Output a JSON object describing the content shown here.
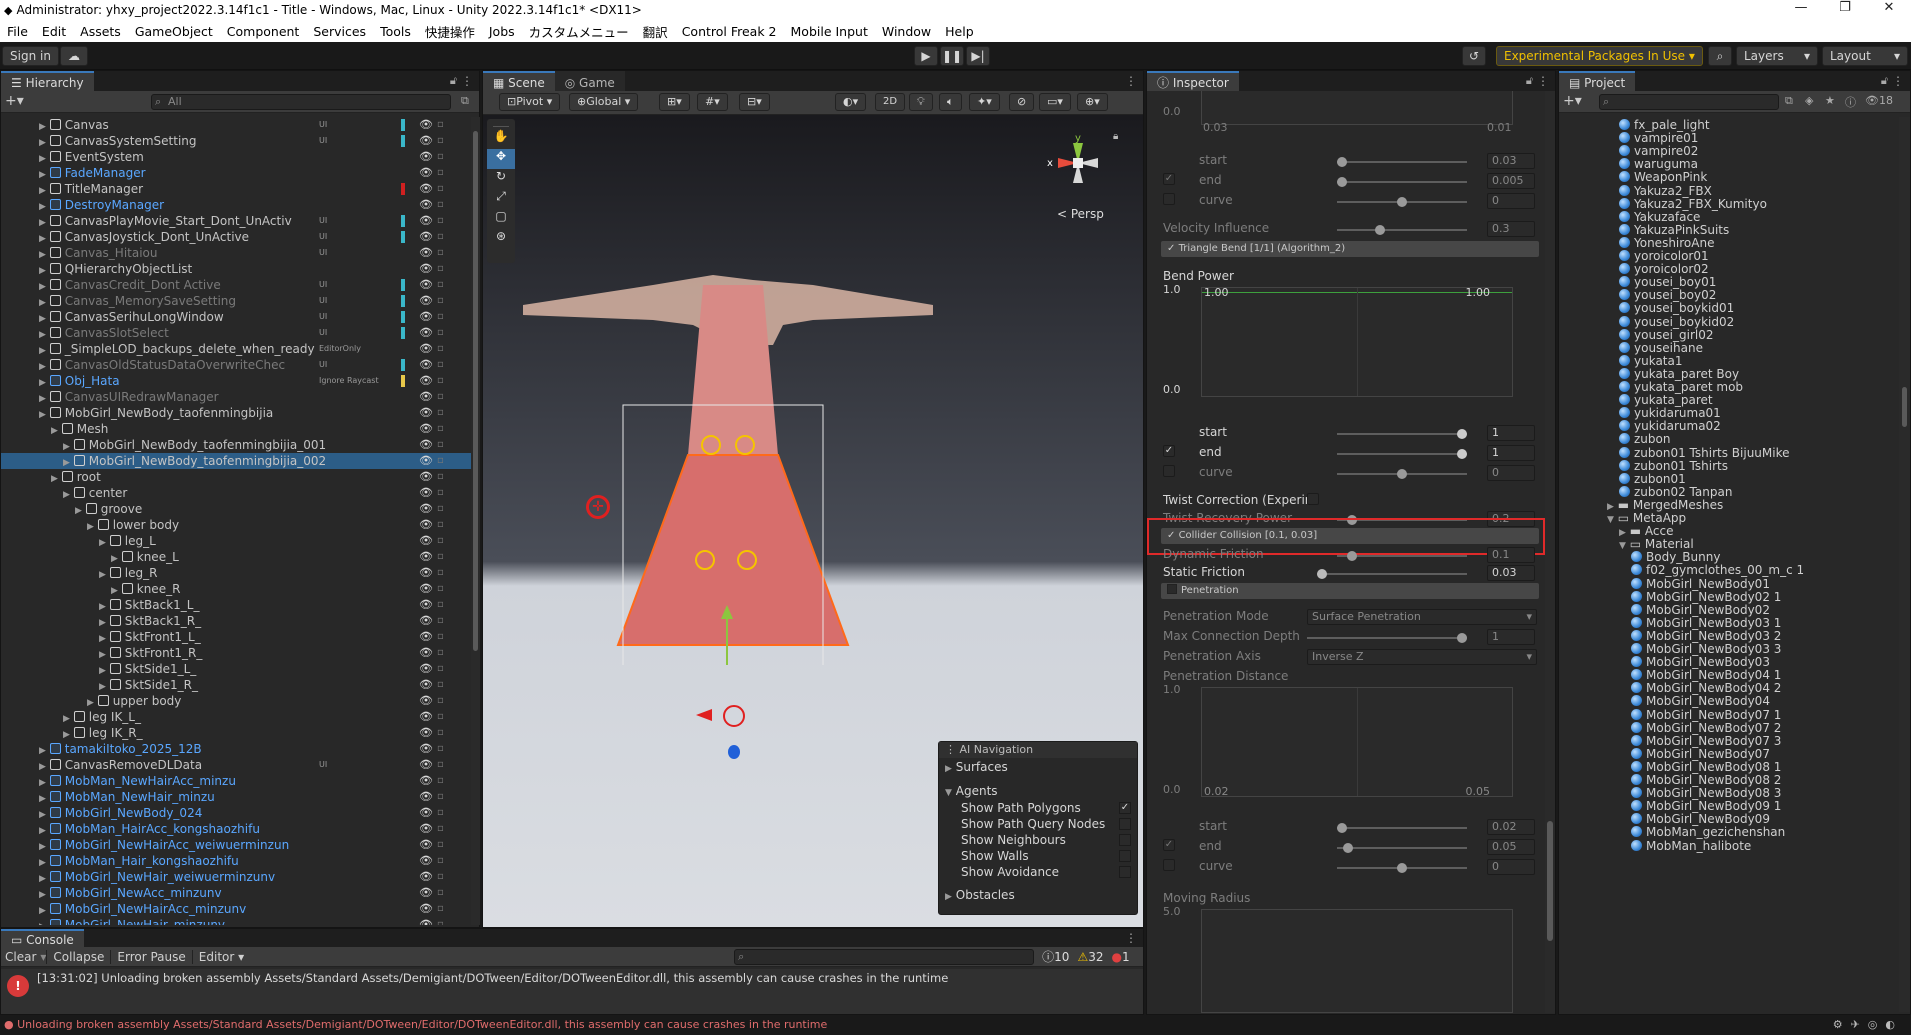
{
  "window": {
    "title": "Administrator: yhxy_project2022.3.14f1c1 - Title - Windows, Mac, Linux - Unity 2022.3.14f1c1* <DX11>"
  },
  "menu": [
    "File",
    "Edit",
    "Assets",
    "GameObject",
    "Component",
    "Services",
    "Tools",
    "快捷操作",
    "Jobs",
    "カスタムメニュー",
    "翻訳",
    "Control Freak 2",
    "Mobile Input",
    "Window",
    "Help"
  ],
  "toolbar": {
    "sign_in": "Sign in",
    "experimental": "Experimental Packages In Use ▾",
    "layers": "Layers",
    "layout": "Layout"
  },
  "hierarchy": {
    "tab": "Hierarchy",
    "search_placeholder": "All",
    "rows": [
      {
        "label": "Canvas",
        "indent": 0,
        "style": "n",
        "tag": "UI",
        "bar": "#3ab7c9"
      },
      {
        "label": "CanvasSystemSetting",
        "indent": 0,
        "style": "n",
        "tag": "UI",
        "bar": "#3ab7c9"
      },
      {
        "label": "EventSystem",
        "indent": 0,
        "style": "n",
        "tag": "",
        "bar": ""
      },
      {
        "label": "FadeManager",
        "indent": 0,
        "style": "b",
        "tag": "",
        "bar": ""
      },
      {
        "label": "TitleManager",
        "indent": 0,
        "style": "n",
        "tag": "",
        "bar": "#d02020"
      },
      {
        "label": "DestroyManager",
        "indent": 0,
        "style": "b",
        "tag": "",
        "bar": ""
      },
      {
        "label": "CanvasPlayMovie_Start_Dont_UnActiv",
        "indent": 0,
        "style": "n",
        "tag": "UI",
        "bar": "#3ab7c9"
      },
      {
        "label": "CanvasJoystick_Dont_UnActive",
        "indent": 0,
        "style": "n",
        "tag": "UI",
        "bar": "#3ab7c9"
      },
      {
        "label": "Canvas_Hitaiou",
        "indent": 0,
        "style": "g",
        "tag": "UI",
        "bar": ""
      },
      {
        "label": "QHierarchyObjectList",
        "indent": 0,
        "style": "n",
        "tag": "",
        "bar": ""
      },
      {
        "label": "CanvasCredit_Dont Active",
        "indent": 0,
        "style": "g",
        "tag": "UI",
        "bar": "#3ab7c9"
      },
      {
        "label": "Canvas_MemorySaveSetting",
        "indent": 0,
        "style": "g",
        "tag": "UI",
        "bar": "#3ab7c9"
      },
      {
        "label": "CanvasSerihuLongWindow",
        "indent": 0,
        "style": "n",
        "tag": "UI",
        "bar": "#3ab7c9"
      },
      {
        "label": "CanvasSlotSelect",
        "indent": 0,
        "style": "g",
        "tag": "UI",
        "bar": "#3ab7c9"
      },
      {
        "label": "_SimpleLOD_backups_delete_when_ready",
        "indent": 0,
        "style": "n",
        "tag": "EditorOnly",
        "bar": ""
      },
      {
        "label": "CanvasOldStatusDataOverwriteChec",
        "indent": 0,
        "style": "g",
        "tag": "UI",
        "bar": "#3ab7c9"
      },
      {
        "label": "Obj_Hata",
        "indent": 0,
        "style": "b",
        "tag": "Ignore Raycast",
        "bar": "#e8c84a"
      },
      {
        "label": "CanvasUIRedrawManager",
        "indent": 0,
        "style": "g",
        "tag": "",
        "bar": ""
      },
      {
        "label": "MobGirl_NewBody_taofenmingbijia",
        "indent": 0,
        "style": "n",
        "tag": "",
        "bar": ""
      },
      {
        "label": "Mesh",
        "indent": 1,
        "style": "n",
        "tag": "",
        "bar": ""
      },
      {
        "label": "MobGirl_NewBody_taofenmingbijia_001",
        "indent": 2,
        "style": "n",
        "tag": "",
        "bar": ""
      },
      {
        "label": "MobGirl_NewBody_taofenmingbijia_002",
        "indent": 2,
        "style": "sel",
        "tag": "",
        "bar": ""
      },
      {
        "label": "root",
        "indent": 1,
        "style": "n",
        "tag": "",
        "bar": ""
      },
      {
        "label": "center",
        "indent": 2,
        "style": "n",
        "tag": "",
        "bar": ""
      },
      {
        "label": "groove",
        "indent": 3,
        "style": "n",
        "tag": "",
        "bar": ""
      },
      {
        "label": "lower body",
        "indent": 4,
        "style": "n",
        "tag": "",
        "bar": ""
      },
      {
        "label": "leg_L",
        "indent": 5,
        "style": "n",
        "tag": "",
        "bar": ""
      },
      {
        "label": "knee_L",
        "indent": 6,
        "style": "n",
        "tag": "",
        "bar": ""
      },
      {
        "label": "leg_R",
        "indent": 5,
        "style": "n",
        "tag": "",
        "bar": ""
      },
      {
        "label": "knee_R",
        "indent": 6,
        "style": "n",
        "tag": "",
        "bar": ""
      },
      {
        "label": "SktBack1_L_",
        "indent": 5,
        "style": "n",
        "tag": "",
        "bar": ""
      },
      {
        "label": "SktBack1_R_",
        "indent": 5,
        "style": "n",
        "tag": "",
        "bar": ""
      },
      {
        "label": "SktFront1_L_",
        "indent": 5,
        "style": "n",
        "tag": "",
        "bar": ""
      },
      {
        "label": "SktFront1_R_",
        "indent": 5,
        "style": "n",
        "tag": "",
        "bar": ""
      },
      {
        "label": "SktSide1_L_",
        "indent": 5,
        "style": "n",
        "tag": "",
        "bar": ""
      },
      {
        "label": "SktSide1_R_",
        "indent": 5,
        "style": "n",
        "tag": "",
        "bar": ""
      },
      {
        "label": "upper body",
        "indent": 4,
        "style": "n",
        "tag": "",
        "bar": ""
      },
      {
        "label": "leg IK_L_",
        "indent": 2,
        "style": "n",
        "tag": "",
        "bar": ""
      },
      {
        "label": "leg IK_R_",
        "indent": 2,
        "style": "n",
        "tag": "",
        "bar": ""
      },
      {
        "label": "tamakiItoko_2025_12B",
        "indent": 0,
        "style": "b",
        "tag": "",
        "bar": ""
      },
      {
        "label": "CanvasRemoveDLData",
        "indent": 0,
        "style": "n",
        "tag": "UI",
        "bar": ""
      },
      {
        "label": "MobMan_NewHairAcc_minzu",
        "indent": 0,
        "style": "b",
        "tag": "",
        "bar": ""
      },
      {
        "label": "MobMan_NewHair_minzu",
        "indent": 0,
        "style": "b",
        "tag": "",
        "bar": ""
      },
      {
        "label": "MobGirl_NewBody_024",
        "indent": 0,
        "style": "b",
        "tag": "",
        "bar": ""
      },
      {
        "label": "MobMan_HairAcc_kongshaozhifu",
        "indent": 0,
        "style": "b",
        "tag": "",
        "bar": ""
      },
      {
        "label": "MobGirl_NewHairAcc_weiwuerminzun",
        "indent": 0,
        "style": "b",
        "tag": "",
        "bar": ""
      },
      {
        "label": "MobMan_Hair_kongshaozhifu",
        "indent": 0,
        "style": "b",
        "tag": "",
        "bar": ""
      },
      {
        "label": "MobGirl_NewHair_weiwuerminzunv",
        "indent": 0,
        "style": "b",
        "tag": "",
        "bar": ""
      },
      {
        "label": "MobGirl_NewAcc_minzunv",
        "indent": 0,
        "style": "b",
        "tag": "",
        "bar": ""
      },
      {
        "label": "MobGirl_NewHairAcc_minzunv",
        "indent": 0,
        "style": "b",
        "tag": "",
        "bar": ""
      },
      {
        "label": "MobGirl_NewHair_minzunv",
        "indent": 0,
        "style": "b",
        "tag": "",
        "bar": ""
      }
    ]
  },
  "scene": {
    "tabs": [
      "Scene",
      "Game"
    ],
    "pivot": "Pivot ▾",
    "global": "Global ▾",
    "mode_2d": "2D",
    "persp": "< Persp",
    "gizmo_axes": {
      "y": "y",
      "x": "x"
    },
    "overlay": {
      "title": "AI Navigation",
      "surfaces": "Surfaces",
      "agents": "Agents",
      "items": [
        "Show Path Polygons",
        "Show Path Query Nodes",
        "Show Neighbours",
        "Show Walls",
        "Show Avoidance"
      ],
      "obstacles": "Obstacles"
    }
  },
  "inspector": {
    "tab": "Inspector",
    "top_vals": {
      "a": "0.0",
      "b": "0.03",
      "c": "0.01"
    },
    "group1": {
      "start": "start",
      "start_v": "0.03",
      "end": "end",
      "end_v": "0.005",
      "curve": "curve",
      "curve_v": "0"
    },
    "velocity": {
      "label": "Velocity Influence",
      "value": "0.3"
    },
    "triangle_bend": "Triangle Bend [1/1] (Algorithm_2)",
    "bend_power": {
      "label": "Bend Power",
      "y_top": "1.0",
      "y_bot": "0.0",
      "left": "1.00",
      "right": "1.00"
    },
    "group2": {
      "start_v": "1",
      "end_v": "1",
      "curve_v": "0"
    },
    "twist": {
      "label": "Twist Correction (Experin"
    },
    "twist_recovery": {
      "label": "Twist Recovery Power",
      "value": "0.2"
    },
    "collider": "Collider Collision [0.1, 0.03]",
    "dynamic_friction": {
      "label": "Dynamic Friction",
      "value": "0.1"
    },
    "static_friction": {
      "label": "Static Friction",
      "value": "0.03"
    },
    "penetration": "Penetration",
    "pen_mode": {
      "label": "Penetration Mode",
      "value": "Surface Penetration"
    },
    "max_depth": {
      "label": "Max Connection Depth",
      "value": "1"
    },
    "pen_axis": {
      "label": "Penetration Axis",
      "value": "Inverse Z"
    },
    "pen_distance": {
      "label": "Penetration Distance",
      "y_top": "1.0",
      "y_bot": "0.0",
      "left": "0.02",
      "right": "0.05"
    },
    "group3": {
      "start_v": "0.02",
      "end_v": "0.05",
      "curve_v": "0"
    },
    "moving_radius": {
      "label": "Moving Radius",
      "y_top": "5.0"
    }
  },
  "project": {
    "tab": "Project",
    "count": "18",
    "rows": [
      {
        "label": "fx_pale_light",
        "indent": 3,
        "type": "s"
      },
      {
        "label": "vampire01",
        "indent": 3,
        "type": "s"
      },
      {
        "label": "vampire02",
        "indent": 3,
        "type": "s"
      },
      {
        "label": "waruguma",
        "indent": 3,
        "type": "s"
      },
      {
        "label": "WeaponPink",
        "indent": 3,
        "type": "s"
      },
      {
        "label": "Yakuza2_FBX",
        "indent": 3,
        "type": "s"
      },
      {
        "label": "Yakuza2_FBX_Kumityo",
        "indent": 3,
        "type": "s"
      },
      {
        "label": "Yakuzaface",
        "indent": 3,
        "type": "s"
      },
      {
        "label": "YakuzaPinkSuits",
        "indent": 3,
        "type": "s"
      },
      {
        "label": "YoneshiroAne",
        "indent": 3,
        "type": "s"
      },
      {
        "label": "yoroicolor01",
        "indent": 3,
        "type": "s"
      },
      {
        "label": "yoroicolor02",
        "indent": 3,
        "type": "s"
      },
      {
        "label": "yousei_boy01",
        "indent": 3,
        "type": "s"
      },
      {
        "label": "yousei_boy02",
        "indent": 3,
        "type": "s"
      },
      {
        "label": "yousei_boykid01",
        "indent": 3,
        "type": "s"
      },
      {
        "label": "yousei_boykid02",
        "indent": 3,
        "type": "s"
      },
      {
        "label": "yousei_girl02",
        "indent": 3,
        "type": "s"
      },
      {
        "label": "youseihane",
        "indent": 3,
        "type": "s"
      },
      {
        "label": "yukata1",
        "indent": 3,
        "type": "s"
      },
      {
        "label": "yukata_paret Boy",
        "indent": 3,
        "type": "s"
      },
      {
        "label": "yukata_paret mob",
        "indent": 3,
        "type": "s"
      },
      {
        "label": "yukata_paret",
        "indent": 3,
        "type": "s"
      },
      {
        "label": "yukidaruma01",
        "indent": 3,
        "type": "s"
      },
      {
        "label": "yukidaruma02",
        "indent": 3,
        "type": "s"
      },
      {
        "label": "zubon",
        "indent": 3,
        "type": "s"
      },
      {
        "label": "zubon01 Tshirts BijuuMike",
        "indent": 3,
        "type": "s"
      },
      {
        "label": "zubon01 Tshirts",
        "indent": 3,
        "type": "s"
      },
      {
        "label": "zubon01",
        "indent": 3,
        "type": "s"
      },
      {
        "label": "zubon02 Tanpan",
        "indent": 3,
        "type": "s"
      },
      {
        "label": "MergedMeshes",
        "indent": 2,
        "type": "f"
      },
      {
        "label": "MetaApp",
        "indent": 2,
        "type": "fo"
      },
      {
        "label": "Acce",
        "indent": 3,
        "type": "f"
      },
      {
        "label": "Material",
        "indent": 3,
        "type": "fo"
      },
      {
        "label": "Body_Bunny",
        "indent": 4,
        "type": "s"
      },
      {
        "label": "f02_gymclothes_00_m_c 1",
        "indent": 4,
        "type": "s"
      },
      {
        "label": "MobGirl_NewBody01",
        "indent": 4,
        "type": "s"
      },
      {
        "label": "MobGirl_NewBody02 1",
        "indent": 4,
        "type": "s"
      },
      {
        "label": "MobGirl_NewBody02",
        "indent": 4,
        "type": "s"
      },
      {
        "label": "MobGirl_NewBody03 1",
        "indent": 4,
        "type": "s"
      },
      {
        "label": "MobGirl_NewBody03 2",
        "indent": 4,
        "type": "s"
      },
      {
        "label": "MobGirl_NewBody03 3",
        "indent": 4,
        "type": "s"
      },
      {
        "label": "MobGirl_NewBody03",
        "indent": 4,
        "type": "s"
      },
      {
        "label": "MobGirl_NewBody04 1",
        "indent": 4,
        "type": "s"
      },
      {
        "label": "MobGirl_NewBody04 2",
        "indent": 4,
        "type": "s"
      },
      {
        "label": "MobGirl_NewBody04",
        "indent": 4,
        "type": "s"
      },
      {
        "label": "MobGirl_NewBody07 1",
        "indent": 4,
        "type": "s"
      },
      {
        "label": "MobGirl_NewBody07 2",
        "indent": 4,
        "type": "s"
      },
      {
        "label": "MobGirl_NewBody07 3",
        "indent": 4,
        "type": "s"
      },
      {
        "label": "MobGirl_NewBody07",
        "indent": 4,
        "type": "s"
      },
      {
        "label": "MobGirl_NewBody08 1",
        "indent": 4,
        "type": "s"
      },
      {
        "label": "MobGirl_NewBody08 2",
        "indent": 4,
        "type": "s"
      },
      {
        "label": "MobGirl_NewBody08 3",
        "indent": 4,
        "type": "s"
      },
      {
        "label": "MobGirl_NewBody09 1",
        "indent": 4,
        "type": "s"
      },
      {
        "label": "MobGirl_NewBody09",
        "indent": 4,
        "type": "s"
      },
      {
        "label": "MobMan_gezichenshan",
        "indent": 4,
        "type": "s"
      },
      {
        "label": "MobMan_halibote",
        "indent": 4,
        "type": "s"
      }
    ]
  },
  "console": {
    "tab": "Console",
    "clear": "Clear",
    "collapse": "Collapse",
    "error_pause": "Error Pause",
    "editor": "Editor ▾",
    "info_count": "10",
    "warn_count": "32",
    "error_count": "1",
    "message": "[13:31:02] Unloading broken assembly Assets/Standard Assets/Demigiant/DOTween/Editor/DOTweenEditor.dll, this assembly can cause crashes in the runtime"
  },
  "statusbar": {
    "message": "Unloading broken assembly Assets/Standard Assets/Demigiant/DOTween/Editor/DOTweenEditor.dll, this assembly can cause crashes in the runtime"
  },
  "colors": {
    "accent": "#3a79bb",
    "highlight": "#e02a2a",
    "selection": "#2c5d87"
  }
}
